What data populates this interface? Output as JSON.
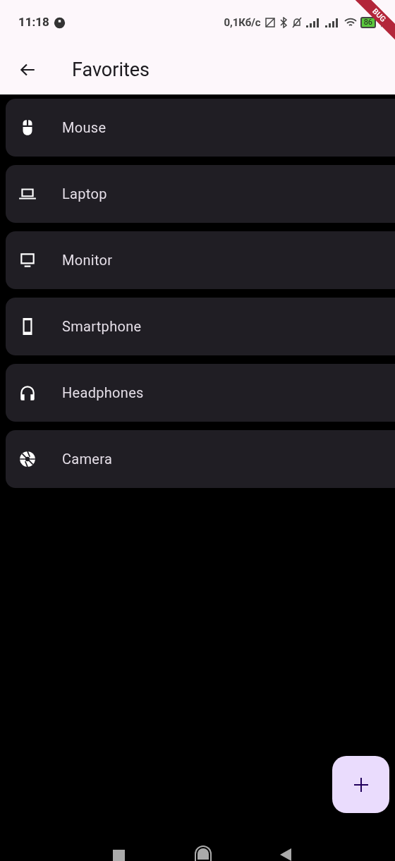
{
  "status_bar": {
    "time": "11:18",
    "network_speed": "0,1Кб/с",
    "battery": "86"
  },
  "debug_banner": "BUG",
  "app_bar": {
    "title": "Favorites"
  },
  "items": [
    {
      "kind": "mouse",
      "label": "Mouse"
    },
    {
      "kind": "laptop",
      "label": "Laptop"
    },
    {
      "kind": "monitor",
      "label": "Monitor"
    },
    {
      "kind": "smartphone",
      "label": "Smartphone"
    },
    {
      "kind": "headphones",
      "label": "Headphones"
    },
    {
      "kind": "camera",
      "label": "Camera"
    }
  ]
}
